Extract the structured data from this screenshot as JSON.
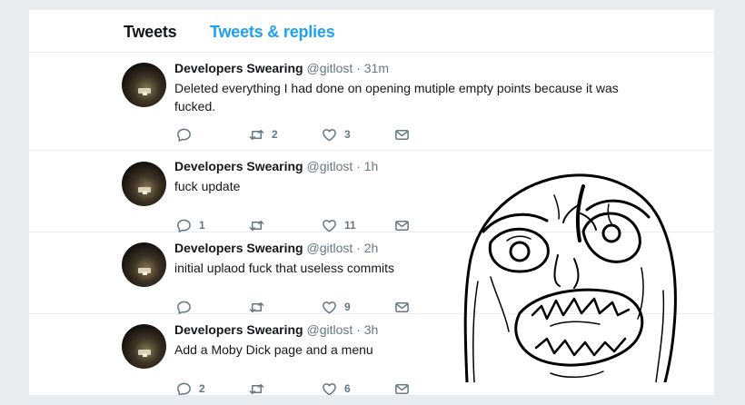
{
  "tabs": {
    "tweets": "Tweets",
    "replies": "Tweets & replies"
  },
  "tweets": [
    {
      "name": "Developers Swearing",
      "handle": "@gitlost",
      "dot": "·",
      "time": "31m",
      "text": "Deleted everything I had done on opening mutiple empty points because it was fucked.",
      "replies": "",
      "retweets": "2",
      "likes": "3"
    },
    {
      "name": "Developers Swearing",
      "handle": "@gitlost",
      "dot": "·",
      "time": "1h",
      "text": "fuck update",
      "replies": "1",
      "retweets": "",
      "likes": "11"
    },
    {
      "name": "Developers Swearing",
      "handle": "@gitlost",
      "dot": "·",
      "time": "2h",
      "text": "initial uplaod fuck that useless commits",
      "replies": "",
      "retweets": "",
      "likes": "9"
    },
    {
      "name": "Developers Swearing",
      "handle": "@gitlost",
      "dot": "·",
      "time": "3h",
      "text": "Add a Moby Dick page and a menu",
      "replies": "2",
      "retweets": "",
      "likes": "6"
    }
  ],
  "icons": {
    "reply": "reply-icon",
    "retweet": "retweet-icon",
    "like": "heart-icon",
    "dm": "envelope-icon"
  },
  "colors": {
    "accent": "#1da1f2",
    "muted": "#657786",
    "background": "#e6ecf0"
  }
}
